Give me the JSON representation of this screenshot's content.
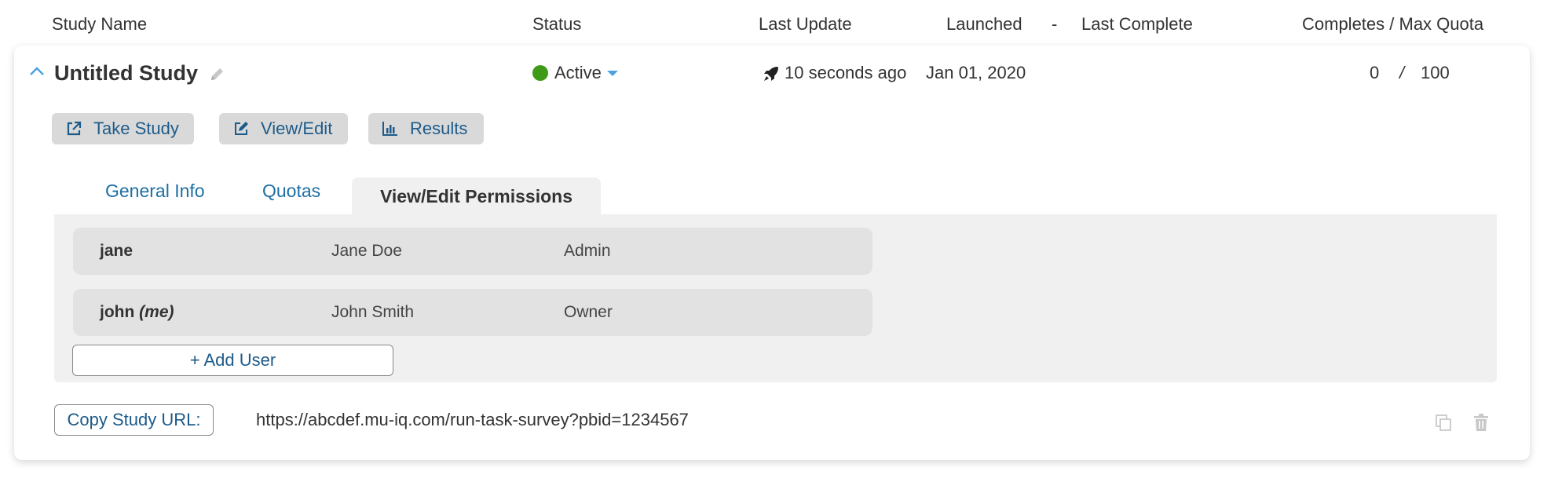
{
  "columns": {
    "study_name": "Study Name",
    "status": "Status",
    "last_update": "Last Update",
    "launched": "Launched",
    "dash": "-",
    "last_complete": "Last Complete",
    "completes_max_quota": "Completes / Max Quota"
  },
  "study": {
    "title": "Untitled Study",
    "status": "Active",
    "status_color": "#3f9b17",
    "last_update": "10 seconds ago",
    "launched": "Jan 01, 2020",
    "completes": "0",
    "separator": "/",
    "max_quota": "100"
  },
  "actions": {
    "take_study": "Take Study",
    "view_edit": "View/Edit",
    "results": "Results"
  },
  "tabs": [
    {
      "label": "General Info",
      "active": false
    },
    {
      "label": "Quotas",
      "active": false
    },
    {
      "label": "View/Edit Permissions",
      "active": true
    }
  ],
  "permissions": [
    {
      "username": "jane",
      "suffix": "",
      "name": "Jane Doe",
      "role": "Admin"
    },
    {
      "username": "john",
      "suffix": "(me)",
      "name": "John Smith",
      "role": "Owner"
    }
  ],
  "add_user_label": "+ Add User",
  "copy_url_label": "Copy Study URL:",
  "study_url": "https://abcdef.mu-iq.com/run-task-survey?pbid=1234567",
  "icons": {
    "collapse": "chevron-up-icon",
    "edit_title": "pencil-icon",
    "status_menu": "caret-down-icon",
    "last_update": "rocket-icon",
    "take_study": "external-link-icon",
    "view_edit": "edit-icon",
    "results": "bar-chart-icon",
    "copy": "copy-icon",
    "delete": "trash-icon"
  },
  "colors": {
    "link": "#1d5b8a",
    "tab_link": "#1d6fa3",
    "caret": "#4aa3df",
    "active_status": "#3f9b17"
  }
}
